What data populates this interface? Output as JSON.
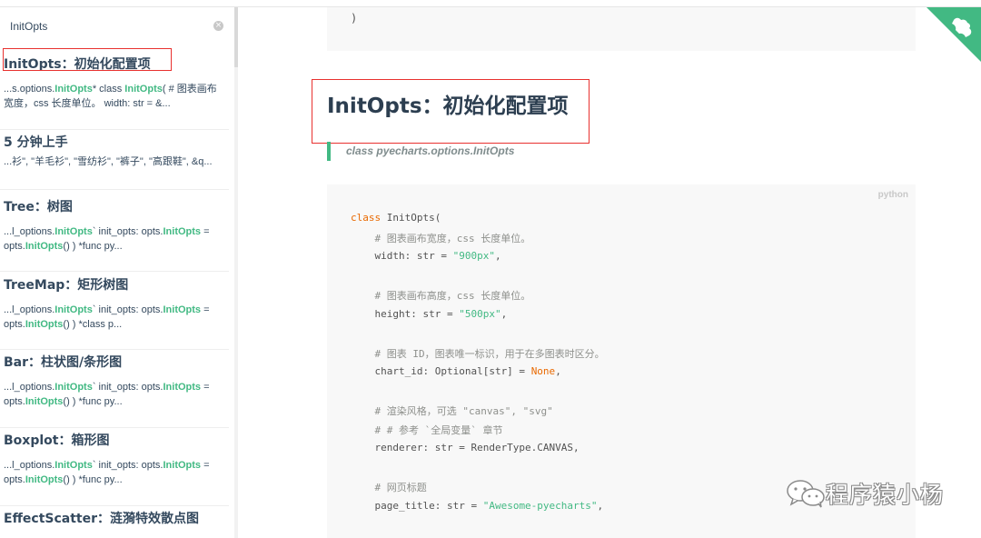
{
  "search": {
    "value": "InitOpts",
    "clear_icon": "clear-circle-icon"
  },
  "results": [
    {
      "title": "InitOpts：初始化配置项",
      "snippet_lines": [
        [
          {
            "t": "...s.options."
          },
          {
            "t": "InitOpts",
            "hl": true
          },
          {
            "t": "* class "
          },
          {
            "t": "InitOpts",
            "hl": true
          },
          {
            "t": "( # 图表画布"
          }
        ],
        [
          {
            "t": "宽度，css 长度单位。 width: str = &..."
          }
        ]
      ]
    },
    {
      "title": "5 分钟上手",
      "snippet_lines": [
        [
          {
            "t": "...衫\", \"羊毛衫\", \"雪纺衫\", \"裤子\", \"高跟鞋\", &q..."
          }
        ]
      ]
    },
    {
      "title": "Tree：树图",
      "snippet_lines": [
        [
          {
            "t": "...l_options."
          },
          {
            "t": "InitOpts",
            "hl": true
          },
          {
            "t": "` init_opts: opts."
          },
          {
            "t": "InitOpts",
            "hl": true
          },
          {
            "t": " ="
          }
        ],
        [
          {
            "t": "opts."
          },
          {
            "t": "InitOpts",
            "hl": true
          },
          {
            "t": "() ) *func py..."
          }
        ]
      ]
    },
    {
      "title": "TreeMap：矩形树图",
      "snippet_lines": [
        [
          {
            "t": "...l_options."
          },
          {
            "t": "InitOpts",
            "hl": true
          },
          {
            "t": "` init_opts: opts."
          },
          {
            "t": "InitOpts",
            "hl": true
          },
          {
            "t": " ="
          }
        ],
        [
          {
            "t": "opts."
          },
          {
            "t": "InitOpts",
            "hl": true
          },
          {
            "t": "() ) *class p..."
          }
        ]
      ]
    },
    {
      "title": "Bar：柱状图/条形图",
      "snippet_lines": [
        [
          {
            "t": "...l_options."
          },
          {
            "t": "InitOpts",
            "hl": true
          },
          {
            "t": "` init_opts: opts."
          },
          {
            "t": "InitOpts",
            "hl": true
          },
          {
            "t": " ="
          }
        ],
        [
          {
            "t": "opts."
          },
          {
            "t": "InitOpts",
            "hl": true
          },
          {
            "t": "() ) *func py..."
          }
        ]
      ]
    },
    {
      "title": "Boxplot：箱形图",
      "snippet_lines": [
        [
          {
            "t": "...l_options."
          },
          {
            "t": "InitOpts",
            "hl": true
          },
          {
            "t": "` init_opts: opts."
          },
          {
            "t": "InitOpts",
            "hl": true
          },
          {
            "t": " ="
          }
        ],
        [
          {
            "t": "opts."
          },
          {
            "t": "InitOpts",
            "hl": true
          },
          {
            "t": "() ) *func py..."
          }
        ]
      ]
    },
    {
      "title": "EffectScatter：涟漪特效散点图",
      "snippet_lines": []
    }
  ],
  "main": {
    "prev_code_tail": ")",
    "title": "InitOpts：初始化配置项",
    "quote": "class pyecharts.options.InitOpts",
    "code_lang": "python",
    "code_lines": [
      [
        {
          "t": "class",
          "c": "kw"
        },
        {
          "t": " InitOpts("
        }
      ],
      [
        {
          "t": "    "
        },
        {
          "t": "# 图表画布宽度，css 长度单位。",
          "c": "cm"
        }
      ],
      [
        {
          "t": "    width: str = "
        },
        {
          "t": "\"900px\"",
          "c": "st"
        },
        {
          "t": ","
        }
      ],
      [],
      [
        {
          "t": "    "
        },
        {
          "t": "# 图表画布高度，css 长度单位。",
          "c": "cm"
        }
      ],
      [
        {
          "t": "    height: str = "
        },
        {
          "t": "\"500px\"",
          "c": "st"
        },
        {
          "t": ","
        }
      ],
      [],
      [
        {
          "t": "    "
        },
        {
          "t": "# 图表 ID，图表唯一标识，用于在多图表时区分。",
          "c": "cm"
        }
      ],
      [
        {
          "t": "    chart_id: Optional[str] = "
        },
        {
          "t": "None",
          "c": "nn"
        },
        {
          "t": ","
        }
      ],
      [],
      [
        {
          "t": "    "
        },
        {
          "t": "# 渲染风格，可选 \"canvas\", \"svg\"",
          "c": "cm"
        }
      ],
      [
        {
          "t": "    "
        },
        {
          "t": "# # 参考 `全局变量` 章节",
          "c": "cm"
        }
      ],
      [
        {
          "t": "    renderer: str = RenderType.CANVAS,"
        }
      ],
      [],
      [
        {
          "t": "    "
        },
        {
          "t": "# 网页标题",
          "c": "cm"
        }
      ],
      [
        {
          "t": "    page_title: str = "
        },
        {
          "t": "\"Awesome-pyecharts\"",
          "c": "st"
        },
        {
          "t": ","
        }
      ]
    ]
  },
  "corner_icon": "github-corner-icon",
  "watermark": {
    "icon": "wechat-icon",
    "text": "程序猿小杨"
  },
  "colors": {
    "accent": "#42b983",
    "highlight_box": "#e8312f",
    "code_keyword": "#e96900"
  }
}
